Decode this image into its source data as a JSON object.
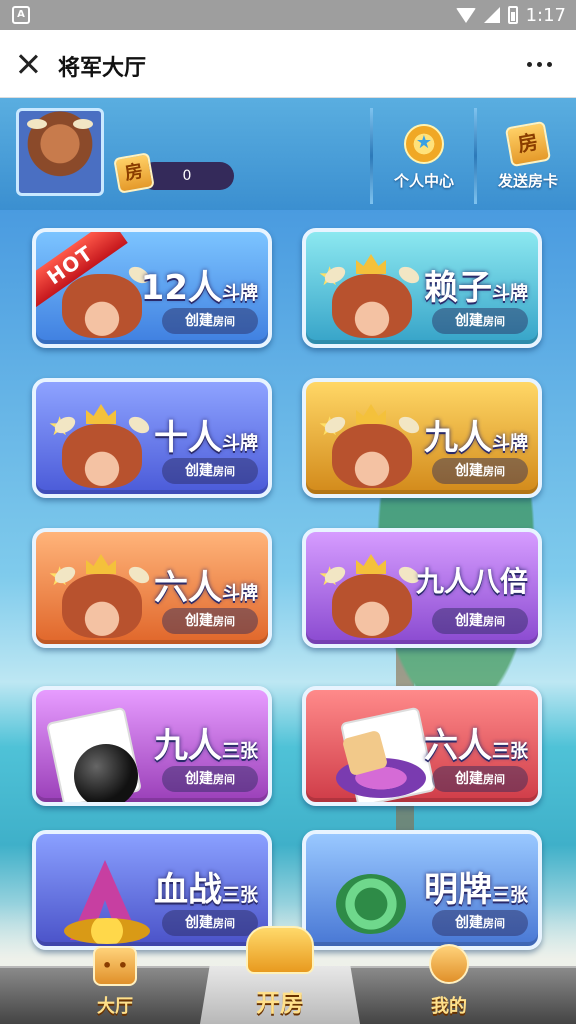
{
  "statusbar": {
    "time": "1:17",
    "left_icon": "A"
  },
  "appbar": {
    "title": "将军大厅",
    "close_icon": "close-icon",
    "more_icon": "more-icon"
  },
  "header": {
    "card_badge": "房",
    "coin_count": "0",
    "buttons": [
      {
        "label": "个人中心",
        "icon": "medal-icon"
      },
      {
        "label": "发送房卡",
        "icon": "room-card-icon",
        "icon_text": "房"
      }
    ]
  },
  "tiles": [
    {
      "name_main": "12人",
      "name_sub": "斗牌",
      "hot": "HOT",
      "create_main": "创建",
      "create_sub": "房间",
      "theme": "blue"
    },
    {
      "name_main": "赖子",
      "name_sub": "斗牌",
      "create_main": "创建",
      "create_sub": "房间",
      "theme": "teal"
    },
    {
      "name_main": "十人",
      "name_sub": "斗牌",
      "create_main": "创建",
      "create_sub": "房间",
      "theme": "indigo"
    },
    {
      "name_main": "九人",
      "name_sub": "斗牌",
      "create_main": "创建",
      "create_sub": "房间",
      "theme": "gold"
    },
    {
      "name_main": "六人",
      "name_sub": "斗牌",
      "create_main": "创建",
      "create_sub": "房间",
      "theme": "orange"
    },
    {
      "name_main": "九人八倍",
      "name_sub": "",
      "create_main": "创建",
      "create_sub": "房间",
      "theme": "purple"
    },
    {
      "name_main": "九人",
      "name_sub": "三张",
      "create_main": "创建",
      "create_sub": "房间",
      "theme": "violet"
    },
    {
      "name_main": "六人",
      "name_sub": "三张",
      "create_main": "创建",
      "create_sub": "房间",
      "theme": "red"
    },
    {
      "name_main": "血战",
      "name_sub": "三张",
      "create_main": "创建",
      "create_sub": "房间",
      "theme": "navy"
    },
    {
      "name_main": "明牌",
      "name_sub": "三张",
      "create_main": "创建",
      "create_sub": "房间",
      "theme": "sky"
    }
  ],
  "bottomnav": [
    {
      "label": "大厅",
      "icon": "dice-icon"
    },
    {
      "label": "开房",
      "icon": "sofa-icon"
    },
    {
      "label": "我的",
      "icon": "user-icon"
    }
  ]
}
